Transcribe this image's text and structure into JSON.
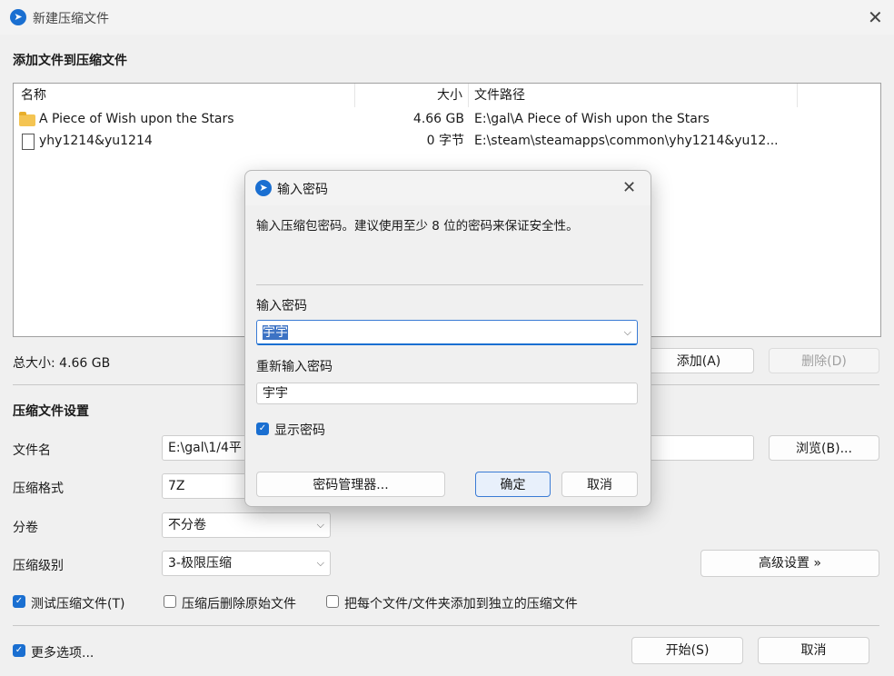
{
  "window": {
    "title": "新建压缩文件"
  },
  "files_section": {
    "title": "添加文件到压缩文件",
    "columns": {
      "name": "名称",
      "size": "大小",
      "path": "文件路径"
    },
    "rows": [
      {
        "icon": "folder-icon",
        "name": "A Piece of Wish upon the Stars",
        "size": "4.66 GB",
        "path": "E:\\gal\\A Piece of Wish upon the Stars"
      },
      {
        "icon": "file-icon",
        "name": "yhy1214&yu1214",
        "size": "0 字节",
        "path": "E:\\steam\\steamapps\\common\\yhy1214&yu12..."
      }
    ]
  },
  "total": "总大小: 4.66 GB",
  "buttons": {
    "add": "添加(A)",
    "delete": "删除(D)",
    "browse": "浏览(B)...",
    "advanced": "高级设置 »",
    "start": "开始(S)",
    "cancel": "取消"
  },
  "settings": {
    "title": "压缩文件设置",
    "filename_label": "文件名",
    "filename_value": "E:\\gal\\1/4平",
    "format_label": "压缩格式",
    "format_value": "7Z",
    "split_label": "分卷",
    "split_value": "不分卷",
    "level_label": "压缩级别",
    "level_value": "3-极限压缩"
  },
  "options": {
    "test": {
      "label": "测试压缩文件(T)",
      "checked": true
    },
    "delete_after": {
      "label": "压缩后删除原始文件",
      "checked": false
    },
    "separate": {
      "label": "把每个文件/文件夹添加到独立的压缩文件",
      "checked": false
    },
    "more": {
      "label": "更多选项...",
      "checked": true
    }
  },
  "dialog": {
    "title": "输入密码",
    "description": "输入压缩包密码。建议使用至少 8 位的密码来保证安全性。",
    "password_label": "输入密码",
    "password_value": "宇宇",
    "confirm_label": "重新输入密码",
    "confirm_value": "宇宇",
    "show_password": {
      "label": "显示密码",
      "checked": true
    },
    "manager_button": "密码管理器...",
    "ok_button": "确定",
    "cancel_button": "取消"
  },
  "colors": {
    "accent": "#1a6fd1",
    "selection": "#3d73c4"
  }
}
